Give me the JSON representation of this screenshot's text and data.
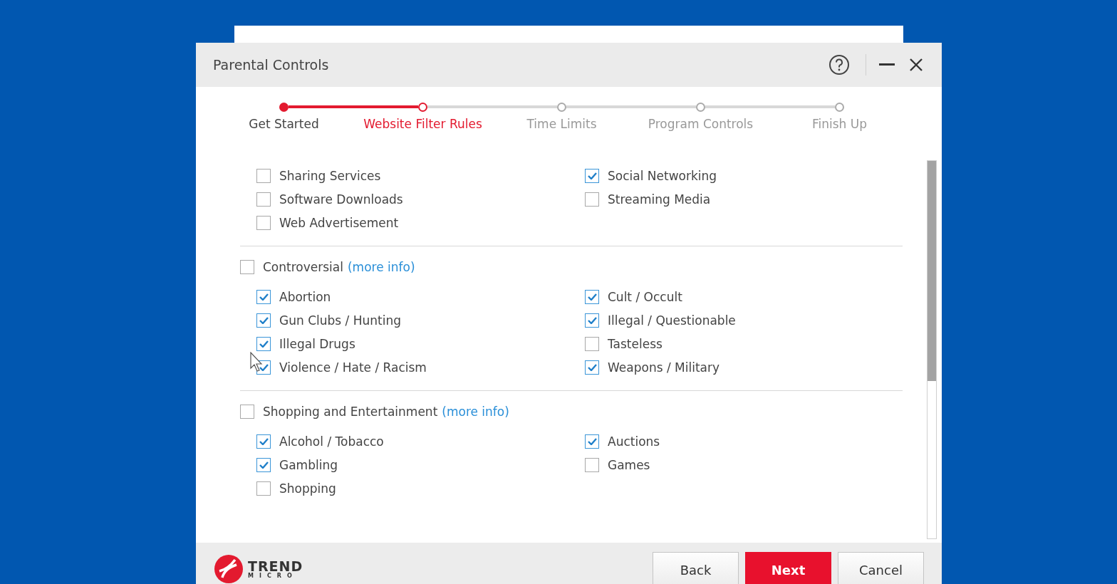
{
  "window": {
    "title": "Parental Controls"
  },
  "steps": [
    {
      "label": "Get Started",
      "completed": true,
      "selected": false
    },
    {
      "label": "Website Filter Rules",
      "completed": false,
      "selected": true
    },
    {
      "label": "Time Limits",
      "completed": false,
      "selected": false
    },
    {
      "label": "Program Controls",
      "completed": false,
      "selected": false
    },
    {
      "label": "Finish Up",
      "completed": false,
      "selected": false
    }
  ],
  "sections": [
    {
      "columns": [
        [
          {
            "label": "Sharing Services",
            "checked": false
          },
          {
            "label": "Software Downloads",
            "checked": false
          },
          {
            "label": "Web Advertisement",
            "checked": false
          }
        ],
        [
          {
            "label": "Social Networking",
            "checked": true
          },
          {
            "label": "Streaming Media",
            "checked": false
          }
        ]
      ]
    },
    {
      "header": {
        "label": "Controversial",
        "link": "(more info)",
        "checked": false
      },
      "columns": [
        [
          {
            "label": "Abortion",
            "checked": true
          },
          {
            "label": "Gun Clubs / Hunting",
            "checked": true
          },
          {
            "label": "Illegal Drugs",
            "checked": true
          },
          {
            "label": "Violence / Hate / Racism",
            "checked": true
          }
        ],
        [
          {
            "label": "Cult / Occult",
            "checked": true
          },
          {
            "label": "Illegal / Questionable",
            "checked": true
          },
          {
            "label": "Tasteless",
            "checked": false
          },
          {
            "label": "Weapons / Military",
            "checked": true
          }
        ]
      ]
    },
    {
      "header": {
        "label": "Shopping and Entertainment",
        "link": "(more info)",
        "checked": false
      },
      "columns": [
        [
          {
            "label": "Alcohol / Tobacco",
            "checked": true
          },
          {
            "label": "Gambling",
            "checked": true
          },
          {
            "label": "Shopping",
            "checked": false
          }
        ],
        [
          {
            "label": "Auctions",
            "checked": true
          },
          {
            "label": "Games",
            "checked": false
          }
        ]
      ]
    }
  ],
  "logo": {
    "word": "TREND",
    "subword": "MICRO"
  },
  "buttons": [
    {
      "label": "Back",
      "kind": "default"
    },
    {
      "label": "Next",
      "kind": "primary"
    },
    {
      "label": "Cancel",
      "kind": "default"
    }
  ]
}
